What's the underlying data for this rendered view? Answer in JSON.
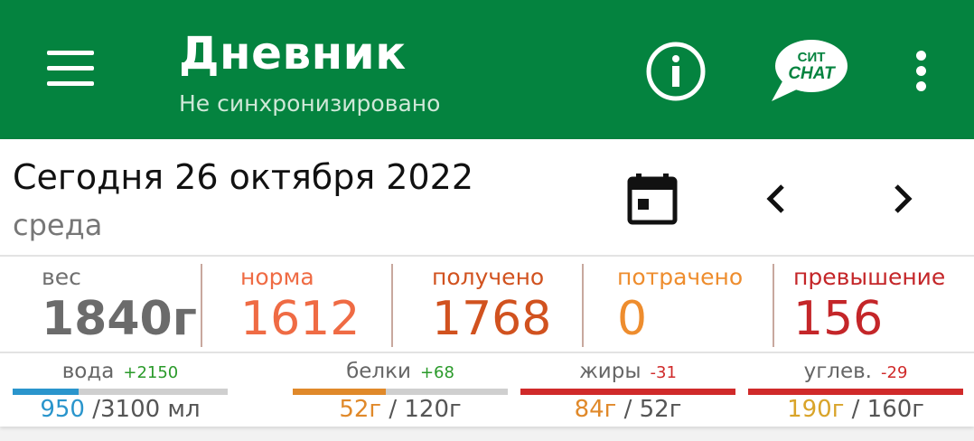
{
  "appbar": {
    "title": "Дневник",
    "subtitle": "Не синхронизировано",
    "chat_icon_top": "СИТ",
    "chat_icon_bottom": "CHAT"
  },
  "date": {
    "line": "Сегодня 26 октября 2022",
    "weekday": "среда"
  },
  "stats": [
    {
      "label": "вес",
      "value": "1840г",
      "label_color": "#707070",
      "value_color": "#6b6b6b"
    },
    {
      "label": "норма",
      "value": "1612",
      "label_color": "#ef6b44",
      "value_color": "#ef6b44"
    },
    {
      "label": "получено",
      "value": "1768",
      "label_color": "#d1521f",
      "value_color": "#d1521f"
    },
    {
      "label": "потрачено",
      "value": "0",
      "label_color": "#ee8d2e",
      "value_color": "#ee8d2e"
    },
    {
      "label": "превышение",
      "value": "156",
      "label_color": "#c42629",
      "value_color": "#c42629"
    }
  ],
  "nutrients": [
    {
      "name": "вода",
      "delta": "+2150",
      "delta_color": "#2a9a2a",
      "current": "950",
      "current_color": "#2a95cc",
      "total": " /3100 мл",
      "bar_color": "#2a95cc",
      "progress": 0.306
    },
    {
      "name": "белки",
      "delta": "+68",
      "delta_color": "#2a9a2a",
      "current": "52г",
      "current_color": "#e0892a",
      "total": " / 120г",
      "bar_color": "#e0892a",
      "progress": 0.433
    },
    {
      "name": "жиры",
      "delta": "-31",
      "delta_color": "#d02a2a",
      "current": "84г",
      "current_color": "#e0892a",
      "total": " / 52г",
      "bar_color": "#d02a2a",
      "progress": 1.0
    },
    {
      "name": "углев.",
      "delta": "-29",
      "delta_color": "#d02a2a",
      "current": "190г",
      "current_color": "#d9a42a",
      "total": " / 160г",
      "bar_color": "#d02a2a",
      "progress": 1.0
    }
  ]
}
